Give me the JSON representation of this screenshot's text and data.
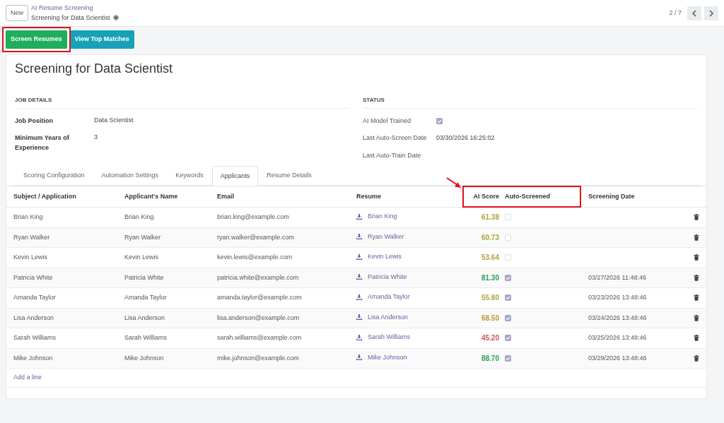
{
  "breadcrumb": {
    "new_button": "New",
    "parent": "AI Resume Screening",
    "current": "Screening for Data Scientist"
  },
  "pager": {
    "text": "2 / 7"
  },
  "actions": [
    {
      "label": "Screen Resumes",
      "kind": "success",
      "highlighted": true
    },
    {
      "label": "View Top Matches",
      "kind": "info",
      "highlighted": false
    }
  ],
  "title": "Screening for Data Scientist",
  "job_details": {
    "heading": "JOB DETAILS",
    "fields": [
      {
        "label": "Job Position",
        "value": "Data Scientist"
      },
      {
        "label": "Minimum Years of Experience",
        "value": "3"
      }
    ]
  },
  "status": {
    "heading": "STATUS",
    "fields": [
      {
        "label": "AI Model Trained",
        "kind": "checkbox",
        "checked": true
      },
      {
        "label": "Last Auto-Screen Date",
        "kind": "text",
        "value": "03/30/2026 16:25:02"
      },
      {
        "label": "Last Auto-Train Date",
        "kind": "text"
      }
    ]
  },
  "tabs": [
    {
      "label": "Scoring Configuration",
      "selected": false
    },
    {
      "label": "Automation Settings",
      "selected": false
    },
    {
      "label": "Keywords",
      "selected": false
    },
    {
      "label": "Applicants",
      "selected": true
    },
    {
      "label": "Resume Details",
      "selected": false
    }
  ],
  "table": {
    "columns": [
      {
        "label": "Subject / Application",
        "highlighted": false
      },
      {
        "label": "Applicant's Name",
        "highlighted": false
      },
      {
        "label": "Email",
        "highlighted": false
      },
      {
        "label": "Resume",
        "highlighted": false
      },
      {
        "label": "AI Score",
        "highlighted": true
      },
      {
        "label": "Auto-Screened",
        "highlighted": true
      },
      {
        "label": "Screening Date",
        "highlighted": false
      }
    ],
    "rows": [
      {
        "subject": "Brian King",
        "name": "Brian King",
        "email": "brian.king@example.com",
        "resume": "Brian King",
        "score": "61.38",
        "color": "#b5a23a",
        "auto_screened": false
      },
      {
        "subject": "Ryan Walker",
        "name": "Ryan Walker",
        "email": "ryan.walker@example.com",
        "resume": "Ryan Walker",
        "score": "60.73",
        "color": "#b5a23a",
        "auto_screened": false
      },
      {
        "subject": "Kevin Lewis",
        "name": "Kevin Lewis",
        "email": "kevin.lewis@example.com",
        "resume": "Kevin Lewis",
        "score": "53.64",
        "color": "#b5a23a",
        "auto_screened": false
      },
      {
        "subject": "Patricia White",
        "name": "Patricia White",
        "email": "patricia.white@example.com",
        "resume": "Patricia White",
        "score": "81.30",
        "color": "#28a05a",
        "auto_screened": true,
        "date": "03/27/2026 11:48:46"
      },
      {
        "subject": "Amanda Taylor",
        "name": "Amanda Taylor",
        "email": "amanda.taylor@example.com",
        "resume": "Amanda Taylor",
        "score": "55.80",
        "color": "#b5a23a",
        "auto_screened": true,
        "date": "03/23/2026 13:48:46"
      },
      {
        "subject": "Lisa Anderson",
        "name": "Lisa Anderson",
        "email": "lisa.anderson@example.com",
        "resume": "Lisa Anderson",
        "score": "68.50",
        "color": "#b59a3a",
        "auto_screened": true,
        "date": "03/24/2026 13:48:46"
      },
      {
        "subject": "Sarah Williams",
        "name": "Sarah Williams",
        "email": "sarah.williams@example.com",
        "resume": "Sarah Williams",
        "score": "45.20",
        "color": "#d0505a",
        "auto_screened": true,
        "date": "03/25/2026 13:48:46"
      },
      {
        "subject": "Mike Johnson",
        "name": "Mike Johnson",
        "email": "mike.johnson@example.com",
        "resume": "Mike Johnson",
        "score": "88.70",
        "color": "#28a05a",
        "auto_screened": true,
        "date": "03/29/2026 13:48:46"
      }
    ],
    "add_line": "Add a line"
  }
}
